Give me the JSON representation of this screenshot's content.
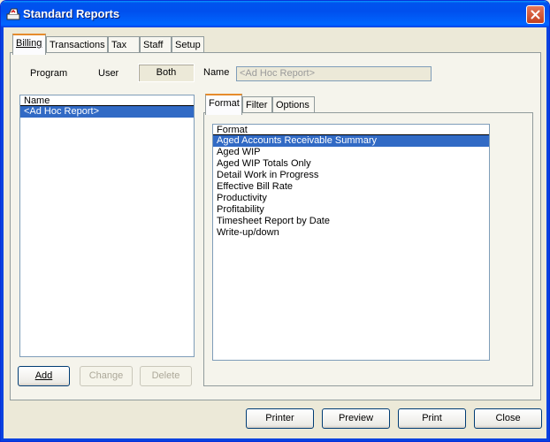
{
  "window": {
    "title": "Standard Reports"
  },
  "main_tabs": [
    {
      "label": "Billing",
      "active": true
    },
    {
      "label": "Transactions",
      "active": false
    },
    {
      "label": "Tax",
      "active": false
    },
    {
      "label": "Staff",
      "active": false
    },
    {
      "label": "Setup",
      "active": false
    }
  ],
  "filter": {
    "program": "Program",
    "user": "User",
    "both": "Both",
    "selected": "Both"
  },
  "name_field": {
    "label": "Name",
    "value": "<Ad Hoc Report>"
  },
  "report_list": {
    "header": "Name",
    "items": [
      {
        "label": "<Ad Hoc Report>",
        "selected": true
      }
    ]
  },
  "sub_tabs": [
    {
      "label": "Format",
      "active": true
    },
    {
      "label": "Filter",
      "active": false
    },
    {
      "label": "Options",
      "active": false
    }
  ],
  "format_list": {
    "header": "Format",
    "items": [
      {
        "label": "Aged Accounts Receivable Summary",
        "selected": true
      },
      {
        "label": "Aged WIP",
        "selected": false
      },
      {
        "label": "Aged WIP Totals Only",
        "selected": false
      },
      {
        "label": "Detail Work in Progress",
        "selected": false
      },
      {
        "label": "Effective Bill Rate",
        "selected": false
      },
      {
        "label": "Productivity",
        "selected": false
      },
      {
        "label": "Profitability",
        "selected": false
      },
      {
        "label": "Timesheet Report by Date",
        "selected": false
      },
      {
        "label": "Write-up/down",
        "selected": false
      }
    ]
  },
  "list_buttons": {
    "add": "Add",
    "change": "Change",
    "delete": "Delete"
  },
  "footer_buttons": {
    "printer": "Printer",
    "preview": "Preview",
    "print": "Print",
    "close": "Close"
  },
  "colors": {
    "titlebar": "#0053ee",
    "selection": "#316ac5",
    "close_button": "#c1401f",
    "active_tab_accent": "#e68b2c"
  },
  "icons": {
    "app": "report-app-icon",
    "close": "close-icon"
  }
}
